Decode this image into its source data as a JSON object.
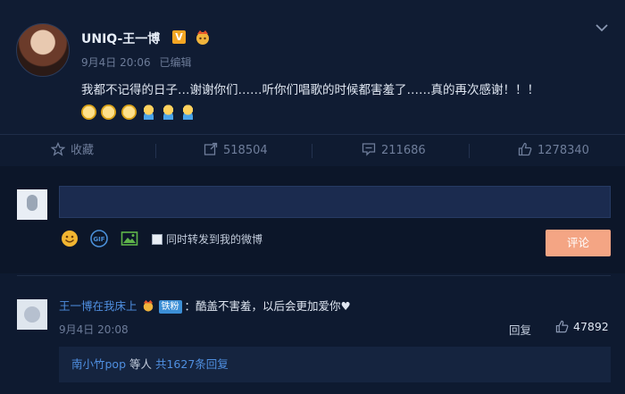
{
  "post": {
    "username": "UNIQ-王一博",
    "verified_badge": "V",
    "date": "9月4日 20:06",
    "edited": "已编辑",
    "text": "我都不记得的日子…谢谢你们……听你们唱歌的时候都害羞了……真的再次感谢！！！",
    "emoji": [
      "cry-emoji",
      "cry-emoji",
      "cry-emoji",
      "hug-emoji",
      "hug-emoji",
      "hug-emoji"
    ]
  },
  "actions": {
    "favorite_label": "收藏",
    "repost_count": "518504",
    "comment_count": "211686",
    "like_count": "1278340"
  },
  "composer": {
    "forward_label": "同时转发到我的微博",
    "submit_label": "评论"
  },
  "comment": {
    "username": "王一博在我床上",
    "fan_badge": "铁粉",
    "text": "：酷盖不害羞，以后会更加爱你♥",
    "time": "9月4日 20:08",
    "reply_label": "回复",
    "like_count": "47892",
    "sub_reply_name": "南小竹pop",
    "sub_reply_mid": " 等人 ",
    "sub_reply_count": "共1627条回复"
  },
  "colors": {
    "accent_link": "#4f8fe0",
    "submit_button": "#f4a584",
    "verified": "#f5a623"
  }
}
